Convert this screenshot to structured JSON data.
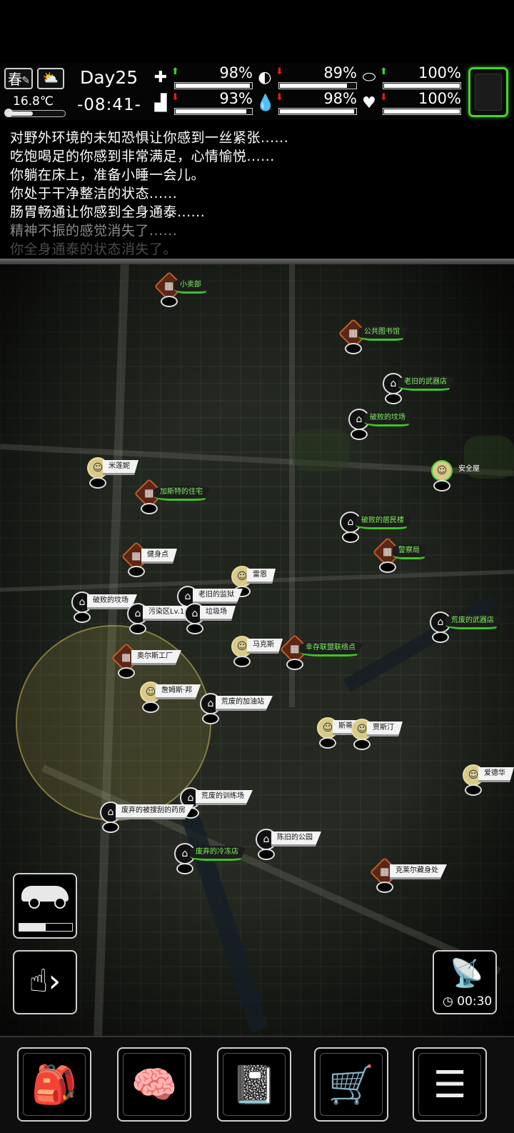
{
  "status": {
    "season": "春",
    "weather_icon": "partly-cloudy-icon",
    "temperature": "16.8℃",
    "temperature_level": 0.45,
    "day": "Day25",
    "time": "-08:41-",
    "stats": [
      {
        "name": "health",
        "icon": "medkit-icon",
        "glyph": "✚",
        "trend": "up",
        "value": "98%",
        "fill": 0.98
      },
      {
        "name": "hunger",
        "icon": "stomach-icon",
        "glyph": "◐",
        "trend": "down",
        "value": "89%",
        "fill": 0.89
      },
      {
        "name": "hygiene",
        "icon": "pill-icon",
        "glyph": "⬭",
        "trend": "up",
        "value": "100%",
        "fill": 1.0
      },
      {
        "name": "stamina",
        "icon": "boot-icon",
        "glyph": "▟",
        "trend": "down",
        "value": "93%",
        "fill": 0.93
      },
      {
        "name": "thirst",
        "icon": "water-drop-icon",
        "glyph": "💧",
        "trend": "down",
        "value": "98%",
        "fill": 0.98
      },
      {
        "name": "mood",
        "icon": "heart-icon",
        "glyph": "♥",
        "trend": "down",
        "value": "100%",
        "fill": 1.0
      }
    ],
    "colors": {
      "up": "#2fd42f",
      "down": "#e31b1b",
      "equip_border": "#4bd12e"
    }
  },
  "log": [
    "对野外环境的未知恐惧让你感到一丝紧张......",
    "吃饱喝足的你感到非常满足，心情愉悦......",
    "你躺在床上，准备小睡一会儿。",
    "你处于干净整洁的状态......",
    "肠胃畅通让你感到全身通泰......",
    "精神不振的感觉消失了......",
    "你全身通泰的状态消失了。"
  ],
  "map": {
    "locations": [
      {
        "label": "小卖部",
        "style": "green",
        "icon": "brown"
      },
      {
        "label": "公共图书馆",
        "style": "green",
        "icon": "brown"
      },
      {
        "label": "老旧的武器店",
        "style": "green",
        "icon": "dark"
      },
      {
        "label": "破败的坟场",
        "style": "green",
        "icon": "dark"
      },
      {
        "label": "米莲妮",
        "style": "white",
        "icon": "npc"
      },
      {
        "label": "安全屋",
        "style": "none",
        "icon": "npc"
      },
      {
        "label": "加斯特的住宅",
        "style": "green",
        "icon": "brown"
      },
      {
        "label": "破败的居民楼",
        "style": "green",
        "icon": "dark"
      },
      {
        "label": "健身点",
        "style": "white",
        "icon": "brown"
      },
      {
        "label": "警察局",
        "style": "green",
        "icon": "brown"
      },
      {
        "label": "雷恩",
        "style": "white",
        "icon": "npc"
      },
      {
        "label": "老旧的监狱",
        "style": "white",
        "icon": "dark"
      },
      {
        "label": "破败的坟场",
        "style": "white",
        "icon": "dark"
      },
      {
        "label": "污染区Lv.1",
        "style": "white",
        "icon": "dark"
      },
      {
        "label": "垃圾场",
        "style": "white",
        "icon": "dark"
      },
      {
        "label": "荒废的武器店",
        "style": "green",
        "icon": "dark"
      },
      {
        "label": "马克斯",
        "style": "white",
        "icon": "npc"
      },
      {
        "label": "幸存联盟联络点",
        "style": "green",
        "icon": "brown"
      },
      {
        "label": "奥尔斯工厂",
        "style": "white",
        "icon": "brown"
      },
      {
        "label": "詹姆斯·邦",
        "style": "white",
        "icon": "npc"
      },
      {
        "label": "荒废的加油站",
        "style": "white",
        "icon": "dark"
      },
      {
        "label": "斯蒂",
        "style": "white",
        "icon": "npc"
      },
      {
        "label": "贾斯汀",
        "style": "white",
        "icon": "npc"
      },
      {
        "label": "爱德华",
        "style": "white",
        "icon": "npc"
      },
      {
        "label": "荒废的训练场",
        "style": "white",
        "icon": "dark"
      },
      {
        "label": "废弃的被搜刮的药房",
        "style": "white",
        "icon": "dark"
      },
      {
        "label": "陈旧的公园",
        "style": "white",
        "icon": "dark"
      },
      {
        "label": "废弃的冷冻店",
        "style": "green",
        "icon": "dark"
      },
      {
        "label": "克莱尔藏身处",
        "style": "white",
        "icon": "brown"
      }
    ],
    "vehicle_fuel": 0.5,
    "radar_timer": "00:30"
  },
  "nav": [
    {
      "name": "backpack",
      "icon": "backpack-icon",
      "glyph": "🎒"
    },
    {
      "name": "skills",
      "icon": "brain-head-icon",
      "glyph": "🧠"
    },
    {
      "name": "journal",
      "icon": "notebook-icon",
      "glyph": "📓"
    },
    {
      "name": "shop",
      "icon": "cart-icon",
      "glyph": "🛒"
    },
    {
      "name": "menu",
      "icon": "list-menu-icon",
      "glyph": "☰"
    }
  ]
}
